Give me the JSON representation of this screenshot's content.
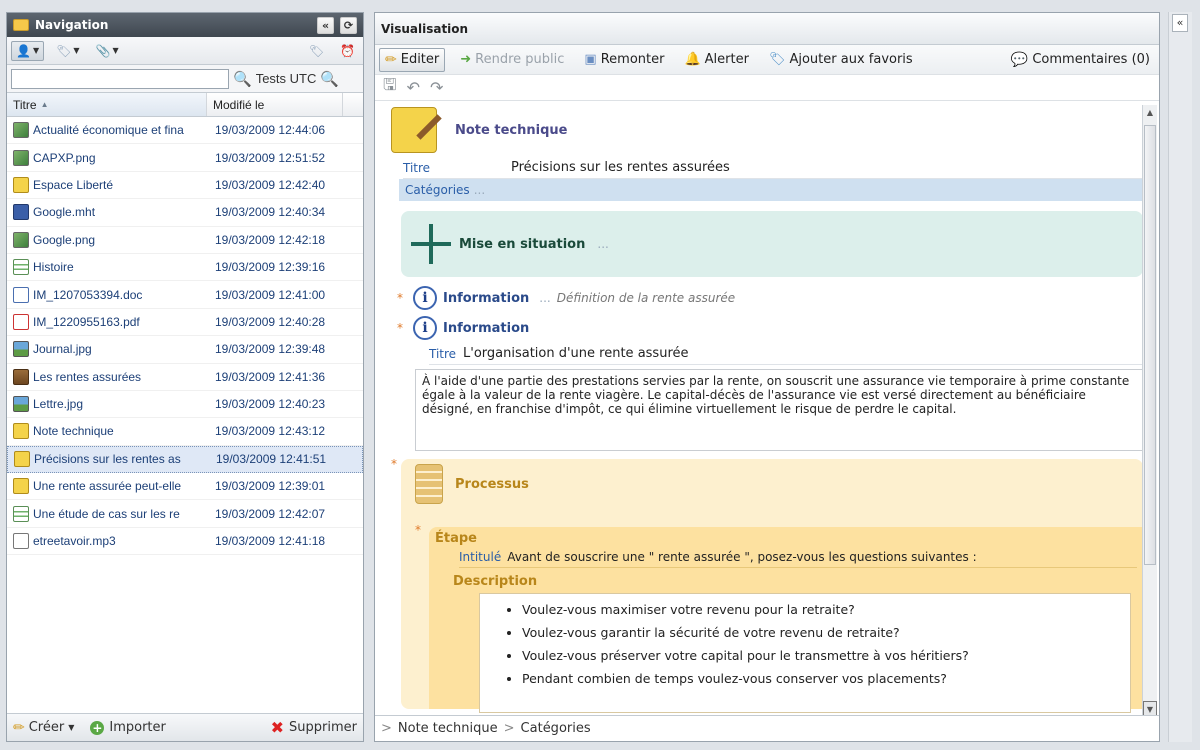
{
  "nav": {
    "title": "Navigation",
    "search": {
      "value": "",
      "placeholder": "",
      "scope_label": "Tests UTC"
    },
    "columns": {
      "title": "Titre",
      "modified": "Modifié le"
    },
    "rows": [
      {
        "name": "Actualité économique et fina",
        "date": "19/03/2009 12:44:06",
        "icon": "image-icon"
      },
      {
        "name": "CAPXP.png",
        "date": "19/03/2009 12:51:52",
        "icon": "image-icon"
      },
      {
        "name": "Espace Liberté",
        "date": "19/03/2009 12:42:40",
        "icon": "note-icon"
      },
      {
        "name": "Google.mht",
        "date": "19/03/2009 12:40:34",
        "icon": "html-icon"
      },
      {
        "name": "Google.png",
        "date": "19/03/2009 12:42:18",
        "icon": "image-icon"
      },
      {
        "name": "Histoire",
        "date": "19/03/2009 12:39:16",
        "icon": "story-icon"
      },
      {
        "name": "IM_1207053394.doc",
        "date": "19/03/2009 12:41:00",
        "icon": "doc-icon"
      },
      {
        "name": "IM_1220955163.pdf",
        "date": "19/03/2009 12:40:28",
        "icon": "pdf-icon"
      },
      {
        "name": "Journal.jpg",
        "date": "19/03/2009 12:39:48",
        "icon": "jpg-icon"
      },
      {
        "name": "Les rentes assurées",
        "date": "19/03/2009 12:41:36",
        "icon": "case-icon"
      },
      {
        "name": "Lettre.jpg",
        "date": "19/03/2009 12:40:23",
        "icon": "jpg-icon"
      },
      {
        "name": "Note technique",
        "date": "19/03/2009 12:43:12",
        "icon": "note-icon"
      },
      {
        "name": "Précisions sur les rentes as",
        "date": "19/03/2009 12:41:51",
        "icon": "note-icon",
        "selected": true
      },
      {
        "name": "Une rente assurée peut-elle",
        "date": "19/03/2009 12:39:01",
        "icon": "note-icon"
      },
      {
        "name": "Une étude de cas sur les re",
        "date": "19/03/2009 12:42:07",
        "icon": "story-icon"
      },
      {
        "name": "etreetavoir.mp3",
        "date": "19/03/2009 12:41:18",
        "icon": "mp3-icon"
      }
    ],
    "footer": {
      "create": "Créer",
      "import": "Importer",
      "delete": "Supprimer"
    }
  },
  "vis": {
    "title": "Visualisation",
    "toolbar": {
      "edit": "Editer",
      "publish": "Rendre public",
      "raise": "Remonter",
      "alert": "Alerter",
      "favorite": "Ajouter aux favoris",
      "comments": "Commentaires (0)"
    },
    "doc": {
      "type_title": "Note technique",
      "title_label": "Titre",
      "title_value": "Précisions sur les rentes assurées",
      "categories_label": "Catégories",
      "dots": "...",
      "mise_title": "Mise en situation",
      "info1_title": "Information",
      "info1_sub": "Définition de la rente assurée",
      "info2_title": "Information",
      "info2_titre_label": "Titre",
      "info2_titre_value": "L'organisation d'une rente assurée",
      "info2_text": "À l'aide d'une partie des prestations servies par la rente, on souscrit une assurance vie temporaire à prime constante égale à la valeur de la rente viagère. Le capital-décès de l'assurance vie est versé directement au bénéficiaire désigné, en franchise d'impôt, ce qui élimine virtuellement le risque de perdre le capital.",
      "processus_title": "Processus",
      "etape_title": "Étape",
      "intitule_label": "Intitulé",
      "intitule_value": "Avant de souscrire une \" rente assurée \", posez-vous les questions suivantes :",
      "description_title": "Description",
      "bullets": [
        "Voulez-vous maximiser votre revenu pour la retraite?",
        "Voulez-vous garantir la sécurité de votre revenu de retraite?",
        "Voulez-vous préserver votre capital pour le transmettre à vos héritiers?",
        "Pendant combien de temps voulez-vous conserver vos placements?"
      ]
    },
    "breadcrumb": [
      "Note technique",
      "Catégories"
    ]
  }
}
